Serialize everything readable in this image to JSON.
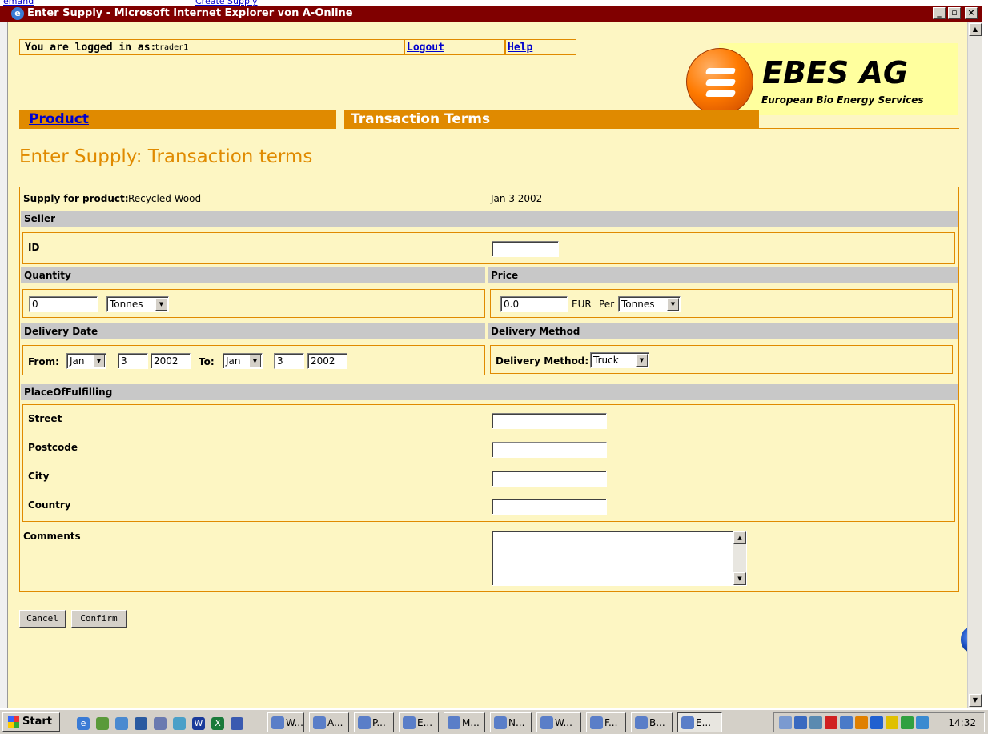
{
  "behind": {
    "left_link": "emand",
    "create_link": "Create Supply"
  },
  "window": {
    "title": "Enter Supply - Microsoft Internet Explorer von A-Online"
  },
  "header": {
    "logged_label": "You are logged in as:",
    "user": "trader1",
    "logout": "Logout",
    "help": "Help"
  },
  "logo": {
    "title": "EBES AG",
    "subtitle": "European Bio Energy Services"
  },
  "tabs": {
    "product": "Product",
    "terms": "Transaction Terms"
  },
  "page_title": "Enter Supply: Transaction terms",
  "form": {
    "supply_label": "Supply for product:",
    "product": "Recycled Wood",
    "date": "Jan 3 2002",
    "seller_header": "Seller",
    "id_label": "ID",
    "id_value": "",
    "quantity_header": "Quantity",
    "quantity_value": "0",
    "quantity_unit": "Tonnes",
    "price_header": "Price",
    "price_value": "0.0",
    "currency": "EUR",
    "per_label": "Per",
    "price_unit": "Tonnes",
    "delivery_date_header": "Delivery Date",
    "from_label": "From:",
    "from_month": "Jan",
    "from_day": "3",
    "from_year": "2002",
    "to_label": "To:",
    "to_month": "Jan",
    "to_day": "3",
    "to_year": "2002",
    "delivery_method_header": "Delivery Method",
    "delivery_method_label": "Delivery Method:",
    "delivery_method_value": "Truck",
    "place_header": "PlaceOfFulfilling",
    "street_label": "Street",
    "postcode_label": "Postcode",
    "city_label": "City",
    "country_label": "Country",
    "comments_label": "Comments"
  },
  "buttons": {
    "cancel": "Cancel",
    "confirm": "Confirm"
  },
  "taskbar": {
    "start": "Start",
    "tasks": [
      "W...",
      "A...",
      "P...",
      "E...",
      "M...",
      "N...",
      "W...",
      "F...",
      "B...",
      "E..."
    ],
    "clock": "14:32"
  },
  "colors": {
    "accent": "#e08a00",
    "page_bg": "#fdf6c3",
    "title_bar": "#800000",
    "section_bar": "#c8c8c8"
  }
}
